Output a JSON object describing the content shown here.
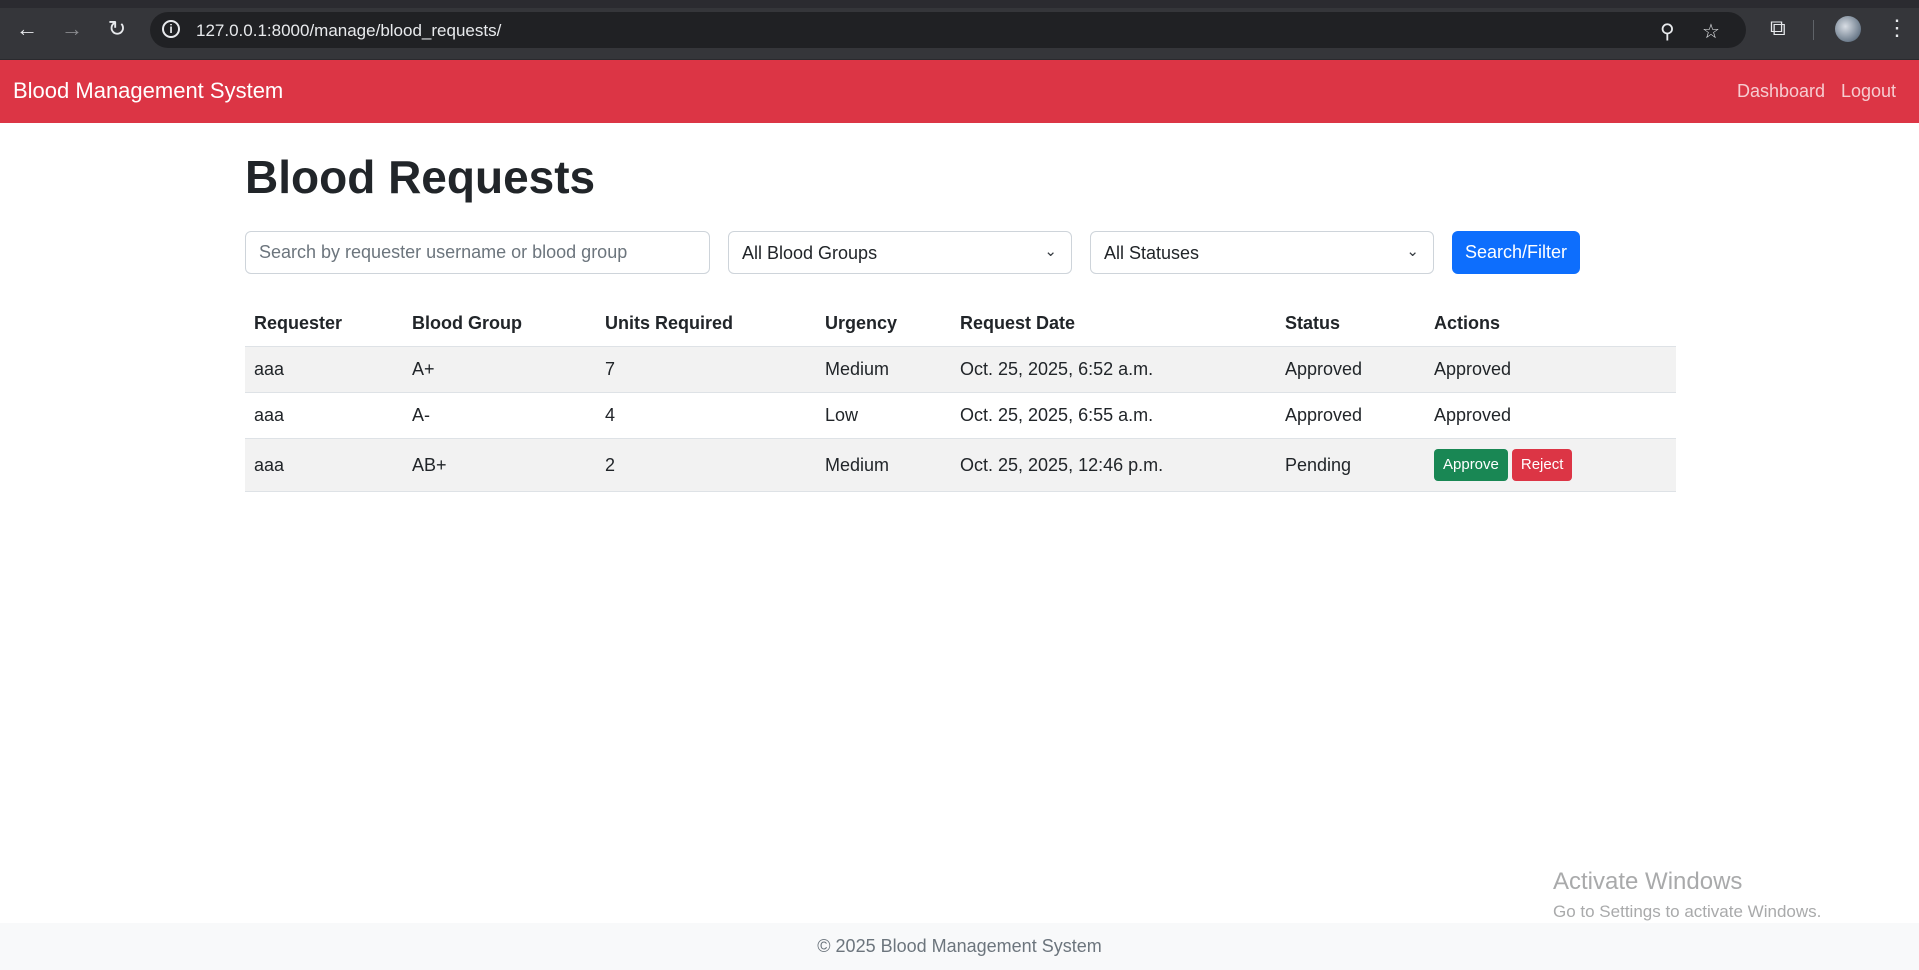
{
  "browser": {
    "url": "127.0.0.1:8000/manage/blood_requests/",
    "back_icon": "arrow-left",
    "forward_icon": "arrow-right",
    "reload_icon": "reload",
    "info_icon": "info",
    "zoom_icon": "zoom",
    "bookmark_icon": "star",
    "extensions_icon": "puzzle",
    "menu_icon": "kebab"
  },
  "navbar": {
    "brand": "Blood Management System",
    "links": [
      "Dashboard",
      "Logout"
    ],
    "color": "#dc3545"
  },
  "page": {
    "title": "Blood Requests"
  },
  "filters": {
    "search_placeholder": "Search by requester username or blood group",
    "search_value": "",
    "blood_group_selected": "All Blood Groups",
    "status_selected": "All Statuses",
    "submit_label": "Search/Filter"
  },
  "table": {
    "columns": [
      "Requester",
      "Blood Group",
      "Units Required",
      "Urgency",
      "Request Date",
      "Status",
      "Actions"
    ],
    "rows": [
      {
        "requester": "aaa",
        "blood_group": "A+",
        "units": "7",
        "urgency": "Medium",
        "date": "Oct. 25, 2025, 6:52 a.m.",
        "status": "Approved",
        "action_text": "Approved"
      },
      {
        "requester": "aaa",
        "blood_group": "A-",
        "units": "4",
        "urgency": "Low",
        "date": "Oct. 25, 2025, 6:55 a.m.",
        "status": "Approved",
        "action_text": "Approved"
      },
      {
        "requester": "aaa",
        "blood_group": "AB+",
        "units": "2",
        "urgency": "Medium",
        "date": "Oct. 25, 2025, 12:46 p.m.",
        "status": "Pending",
        "approve_label": "Approve",
        "reject_label": "Reject"
      }
    ]
  },
  "watermark": {
    "title": "Activate Windows",
    "subtitle": "Go to Settings to activate Windows."
  },
  "footer": {
    "text": "© 2025 Blood Management System"
  },
  "colors": {
    "primary": "#0d6efd",
    "success": "#198754",
    "danger": "#dc3545"
  }
}
